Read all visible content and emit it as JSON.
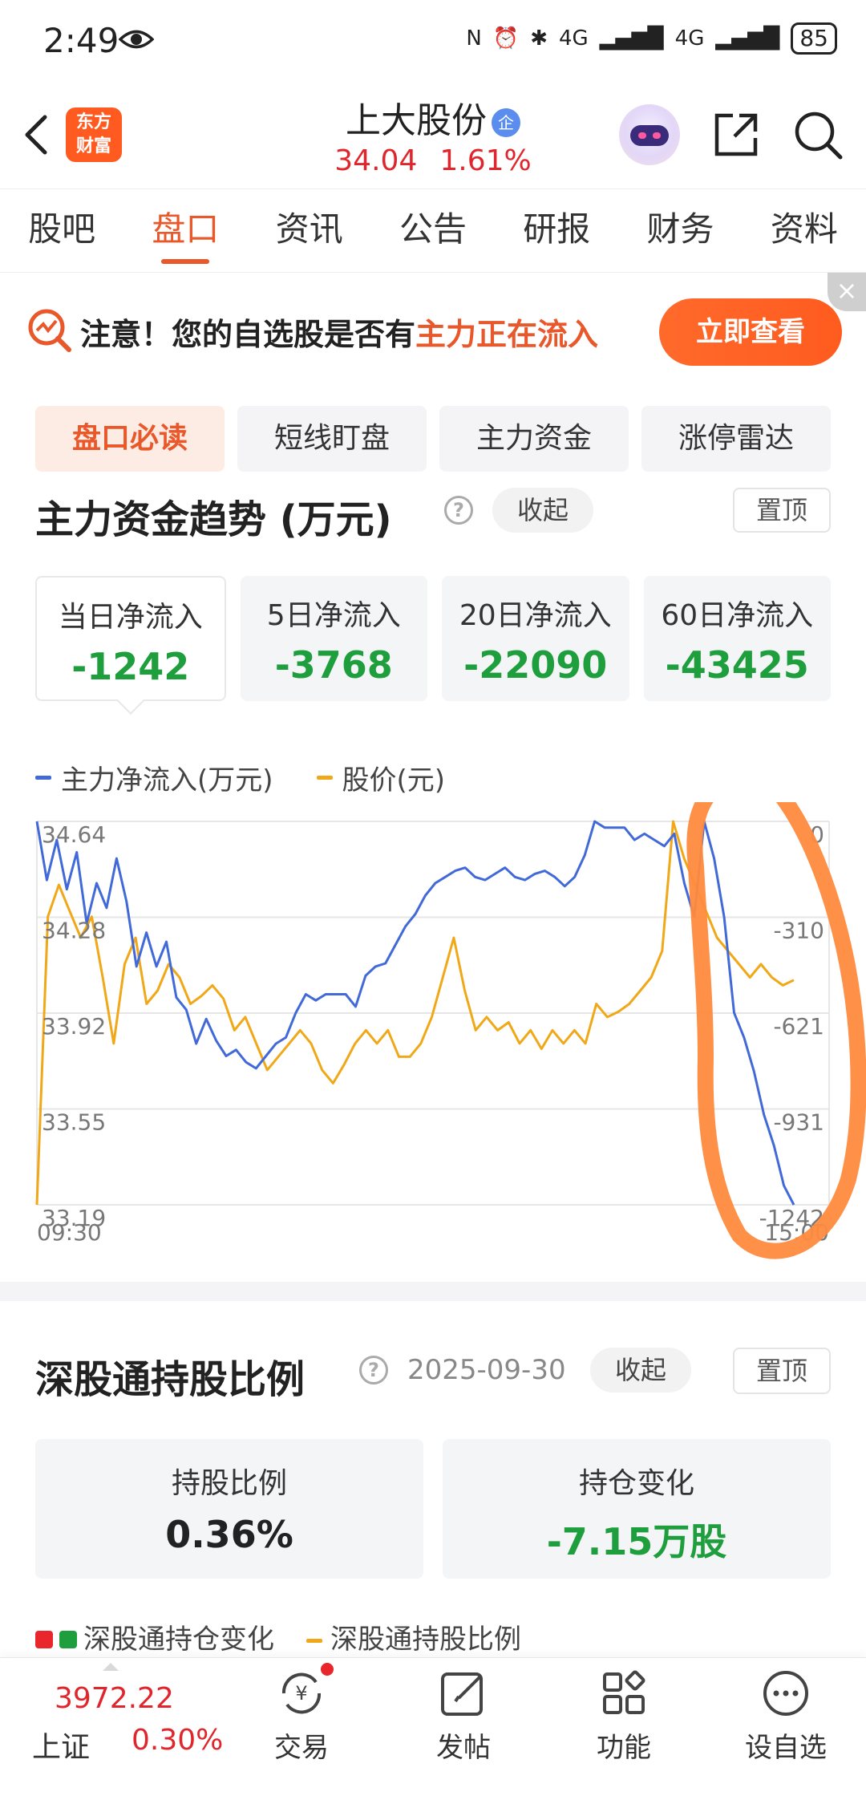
{
  "status_bar": {
    "time": "2:49",
    "battery": "85",
    "signal1": "4G",
    "signal2": "4G"
  },
  "header": {
    "logo_line1": "东方",
    "logo_line2": "财富",
    "stock_name": "上大股份",
    "stock_tag": "企",
    "price": "34.04",
    "change_pct": "1.61%"
  },
  "tabs": [
    "股吧",
    "盘口",
    "资讯",
    "公告",
    "研报",
    "财务",
    "资料"
  ],
  "banner": {
    "text_prefix": "注意！您的自选股是否有",
    "text_highlight": "主力正在流入",
    "button": "立即查看"
  },
  "subtabs": [
    "盘口必读",
    "短线盯盘",
    "主力资金",
    "涨停雷达"
  ],
  "fund_section": {
    "title": "主力资金趋势 (万元)",
    "collapse": "收起",
    "pin": "置顶",
    "cards": [
      {
        "label": "当日净流入",
        "value": "-1242"
      },
      {
        "label": "5日净流入",
        "value": "-3768"
      },
      {
        "label": "20日净流入",
        "value": "-22090"
      },
      {
        "label": "60日净流入",
        "value": "-43425"
      }
    ],
    "legend_flow": "主力净流入(万元)",
    "legend_price": "股价(元)",
    "colors": {
      "flow": "#4169d8",
      "price": "#f0a818",
      "circle": "#ff8a3d"
    }
  },
  "chart_data": {
    "type": "line",
    "x_start_label": "09:30",
    "x_end_label": "15:00",
    "left_axis_ticks": [
      "34.64",
      "34.28",
      "33.92",
      "33.55",
      "33.19"
    ],
    "right_axis_ticks": [
      "0",
      "-310",
      "-621",
      "-931",
      "-1242"
    ],
    "series": [
      {
        "name": "主力净流入(万元)",
        "axis": "right",
        "points": [
          0,
          -190,
          -60,
          -220,
          -100,
          -330,
          -200,
          -280,
          -120,
          -260,
          -470,
          -360,
          -470,
          -390,
          -570,
          -610,
          -720,
          -640,
          -710,
          -760,
          -740,
          -780,
          -800,
          -760,
          -720,
          -700,
          -620,
          -560,
          -580,
          -560,
          -560,
          -560,
          -600,
          -500,
          -470,
          -460,
          -400,
          -340,
          -300,
          -240,
          -200,
          -180,
          -160,
          -150,
          -180,
          -190,
          -170,
          -150,
          -180,
          -190,
          -170,
          -160,
          -180,
          -210,
          -180,
          -110,
          0,
          -20,
          -20,
          -20,
          -60,
          -40,
          -60,
          -80,
          -40,
          -200,
          -310,
          0,
          -120,
          -310,
          -620,
          -700,
          -810,
          -950,
          -1050,
          -1180,
          -1242
        ],
        "color": "#4169d8"
      },
      {
        "name": "股价(元)",
        "axis": "left",
        "points": [
          33.19,
          34.28,
          34.4,
          34.3,
          34.2,
          34.28,
          34.05,
          33.8,
          34.1,
          34.2,
          33.95,
          34.0,
          34.1,
          34.05,
          33.95,
          33.98,
          34.02,
          33.97,
          33.85,
          33.9,
          33.8,
          33.7,
          33.75,
          33.8,
          33.85,
          33.8,
          33.7,
          33.65,
          33.72,
          33.8,
          33.85,
          33.8,
          33.85,
          33.75,
          33.75,
          33.8,
          33.9,
          34.05,
          34.2,
          34.0,
          33.85,
          33.9,
          33.85,
          33.88,
          33.8,
          33.85,
          33.78,
          33.85,
          33.8,
          33.85,
          33.8,
          33.95,
          33.9,
          33.92,
          33.95,
          34.0,
          34.05,
          34.15,
          34.64,
          34.5,
          34.4,
          34.3,
          34.2,
          34.15,
          34.1,
          34.05,
          34.1,
          34.05,
          34.02,
          34.04
        ],
        "color": "#f0a818"
      }
    ]
  },
  "hold_section": {
    "title": "深股通持股比例",
    "date": "2025-09-30",
    "collapse": "收起",
    "pin": "置顶",
    "ratio_label": "持股比例",
    "ratio_value": "0.36%",
    "change_label": "持仓变化",
    "change_value": "-7.15万股",
    "legend_change": "深股通持仓变化",
    "legend_ratio": "深股通持股比例"
  },
  "bottom_nav": {
    "index_value": "3972.22",
    "index_name": "上证",
    "index_pct": "0.30%",
    "items": [
      "交易",
      "发帖",
      "功能",
      "设自选"
    ]
  }
}
